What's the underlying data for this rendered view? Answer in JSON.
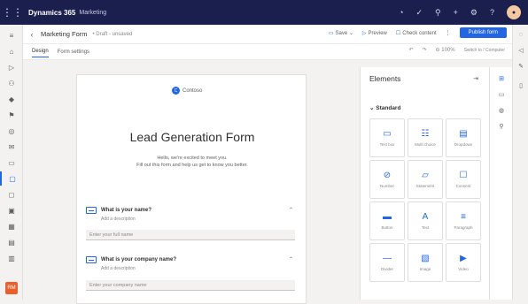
{
  "header": {
    "app_title": "Dynamics 365",
    "app_subtitle": "Marketing"
  },
  "command_bar": {
    "form_title": "Marketing Form",
    "form_status": "• Draft - unsaved",
    "save_label": "Save",
    "preview_label": "Preview",
    "check_content_label": "Check content",
    "publish_label": "Publish form"
  },
  "tabs": [
    {
      "label": "Design"
    },
    {
      "label": "Form settings"
    }
  ],
  "subbar": {
    "zoom": "100%",
    "device_label": "Switch to / Computer"
  },
  "form": {
    "logo_text": "Contoso",
    "title": "Lead Generation Form",
    "description_line1": "Hello, we're excited to meet you.",
    "description_line2": "Fill out this form and help us get to know you better.",
    "questions": [
      {
        "label": "What is your name?",
        "help": "Add a description",
        "placeholder": "Enter your full name"
      },
      {
        "label": "What is your company name?",
        "help": "Add a description",
        "placeholder": "Enter your company name"
      }
    ]
  },
  "elements_panel": {
    "title": "Elements",
    "section": "Standard",
    "tiles": [
      {
        "label": "Text box",
        "icon": "text-box-icon",
        "glyph": "▭"
      },
      {
        "label": "Multi choice",
        "icon": "multi-choice-icon",
        "glyph": "☷"
      },
      {
        "label": "Dropdown",
        "icon": "dropdown-icon",
        "glyph": "▤"
      },
      {
        "label": "Number",
        "icon": "number-icon",
        "glyph": "⊘"
      },
      {
        "label": "Statement",
        "icon": "statement-icon",
        "glyph": "▱"
      },
      {
        "label": "Consent",
        "icon": "consent-icon",
        "glyph": "☐"
      },
      {
        "label": "Button",
        "icon": "button-icon",
        "glyph": "▬"
      },
      {
        "label": "Text",
        "icon": "text-icon",
        "glyph": "A"
      },
      {
        "label": "Paragraph",
        "icon": "paragraph-icon",
        "glyph": "≡"
      },
      {
        "label": "Divider",
        "icon": "divider-icon",
        "glyph": "—"
      },
      {
        "label": "Image",
        "icon": "image-icon",
        "glyph": "▧"
      },
      {
        "label": "Video",
        "icon": "video-icon",
        "glyph": "▶"
      }
    ]
  }
}
